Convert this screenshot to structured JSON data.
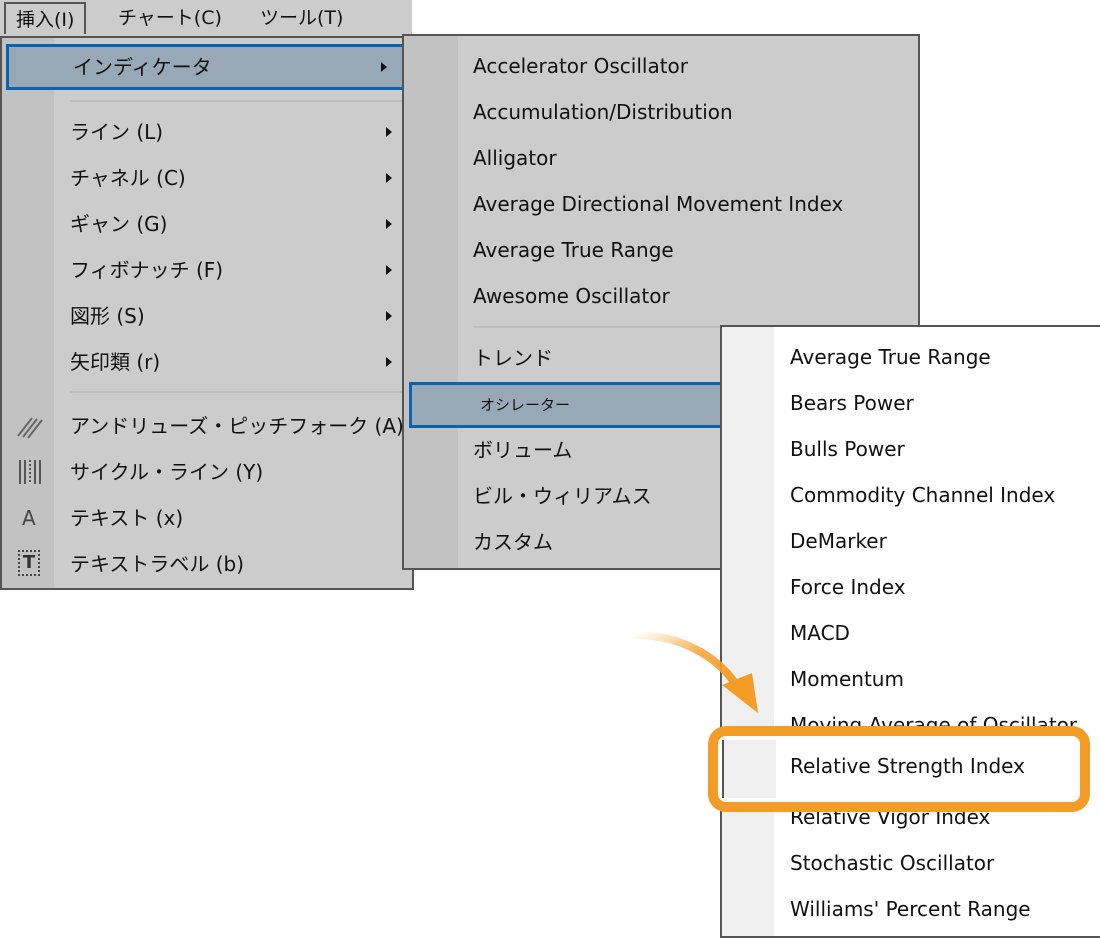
{
  "menubar": {
    "items": [
      {
        "label": "挿入(I)",
        "pressed": true
      },
      {
        "label": "チャート(C)",
        "pressed": false
      },
      {
        "label": "ツール(T)",
        "pressed": false
      }
    ]
  },
  "insert_menu": {
    "items": [
      {
        "label": "インディケータ",
        "has_submenu": true,
        "active": true
      },
      {
        "label": "ライン (L)",
        "has_submenu": true
      },
      {
        "label": "チャネル (C)",
        "has_submenu": true
      },
      {
        "label": "ギャン (G)",
        "has_submenu": true
      },
      {
        "label": "フィボナッチ (F)",
        "has_submenu": true
      },
      {
        "label": "図形 (S)",
        "has_submenu": true
      },
      {
        "label": "矢印類 (r)",
        "has_submenu": true
      },
      {
        "label": "アンドリューズ・ピッチフォーク (A)",
        "icon": "pitchfork-icon"
      },
      {
        "label": "サイクル・ライン (Y)",
        "icon": "cycle-lines-icon"
      },
      {
        "label": "テキスト (x)",
        "icon": "text-icon",
        "icon_glyph": "A"
      },
      {
        "label": "テキストラベル (b)",
        "icon": "text-label-icon",
        "icon_glyph": "T"
      }
    ]
  },
  "indicators_menu": {
    "items": [
      {
        "label": "Accelerator Oscillator"
      },
      {
        "label": "Accumulation/Distribution"
      },
      {
        "label": "Alligator"
      },
      {
        "label": "Average Directional Movement Index"
      },
      {
        "label": "Average True Range"
      },
      {
        "label": "Awesome Oscillator"
      },
      {
        "label": "トレンド"
      },
      {
        "label": "オシレーター",
        "active": true
      },
      {
        "label": "ボリューム"
      },
      {
        "label": "ビル・ウィリアムス"
      },
      {
        "label": "カスタム"
      }
    ]
  },
  "oscillators_menu": {
    "items": [
      {
        "label": "Average True Range"
      },
      {
        "label": "Bears Power"
      },
      {
        "label": "Bulls Power"
      },
      {
        "label": "Commodity Channel Index"
      },
      {
        "label": "DeMarker"
      },
      {
        "label": "Force Index"
      },
      {
        "label": "MACD"
      },
      {
        "label": "Momentum"
      },
      {
        "label": "Moving Average of Oscillator"
      },
      {
        "label": "Relative Strength Index",
        "highlighted": true
      },
      {
        "label": "Relative Vigor Index"
      },
      {
        "label": "Stochastic Oscillator"
      },
      {
        "label": "Williams' Percent Range"
      }
    ]
  },
  "colors": {
    "menu_bg": "#cccccc",
    "active_bg": "#98a8b6",
    "active_border": "#0a62b0",
    "highlight": "#f39c27"
  }
}
